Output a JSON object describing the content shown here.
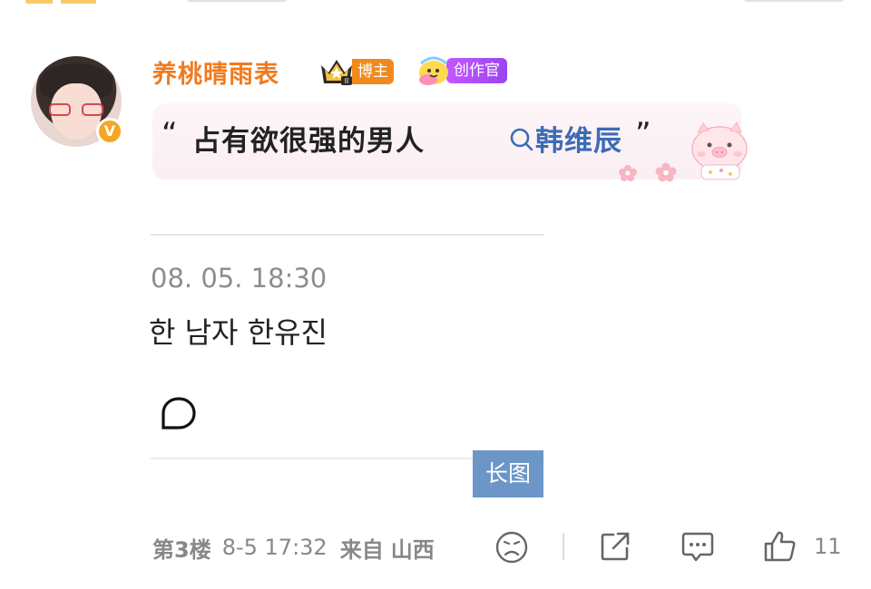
{
  "comment": {
    "username": "养桃晴雨表",
    "badges": {
      "blogger": "博主",
      "creator": "创作官"
    },
    "open_quote": "“",
    "text": "占有欲很强的男人",
    "search_link": "韩维辰",
    "close_quote": "”"
  },
  "quoted_image": {
    "date": "08. 05. 18:30",
    "line": "한 남자 한유진",
    "long_image_label": "长图"
  },
  "meta": {
    "floor": "第3楼",
    "time": "8-5 17:32",
    "from_label": "来自",
    "location": "山西"
  },
  "actions": {
    "like_count": "11"
  },
  "icons": {
    "avatar_badge": "verified-v-icon",
    "search": "search-icon",
    "dislike": "sad-face-icon",
    "share": "share-icon",
    "comment": "comment-icon",
    "like": "thumbs-up-icon"
  },
  "colors": {
    "username": "#f07a1f",
    "link": "#3d6bb6",
    "long_image_bg": "#6c96c8",
    "blogger_badge": "#f08a1c",
    "creator_badge": "#a64cf3"
  }
}
